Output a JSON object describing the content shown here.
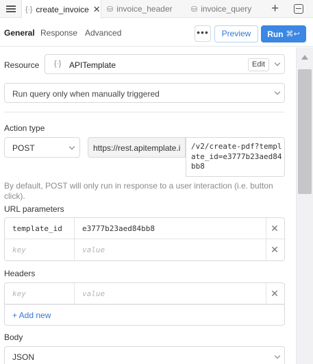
{
  "tabs": [
    {
      "label": "create_invoice",
      "icon": "braces-icon",
      "active": true
    },
    {
      "label": "invoice_header",
      "icon": "database-icon",
      "active": false
    },
    {
      "label": "invoice_query",
      "icon": "database-icon",
      "active": false
    }
  ],
  "subnav": {
    "tabs": [
      "General",
      "Response",
      "Advanced"
    ],
    "more_label": "•••",
    "preview_label": "Preview",
    "run_label": "Run",
    "run_shortcut": "⌘↩"
  },
  "resource": {
    "label": "Resource",
    "icon_glyph": "{∙}",
    "name": "APITemplate",
    "edit_label": "Edit"
  },
  "trigger": {
    "value": "Run query only when manually triggered"
  },
  "action": {
    "label": "Action type",
    "method": "POST",
    "base_url": "https://rest.apitemplate.i",
    "path": "/v2/create-pdf?template_id=e3777b23aed84bb8"
  },
  "hint": "By default, POST will only run in response to a user interaction (i.e. button click).",
  "url_params": {
    "label": "URL parameters",
    "rows": [
      {
        "key": "template_id",
        "value": "e3777b23aed84bb8"
      },
      {
        "key": "",
        "value": ""
      }
    ],
    "key_placeholder": "key",
    "value_placeholder": "value"
  },
  "headers": {
    "label": "Headers",
    "key_placeholder": "key",
    "value_placeholder": "value",
    "add_label": "+ Add new"
  },
  "body": {
    "label": "Body",
    "type": "JSON"
  },
  "colors": {
    "accent": "#3b87e3",
    "link": "#2f7ad8"
  }
}
